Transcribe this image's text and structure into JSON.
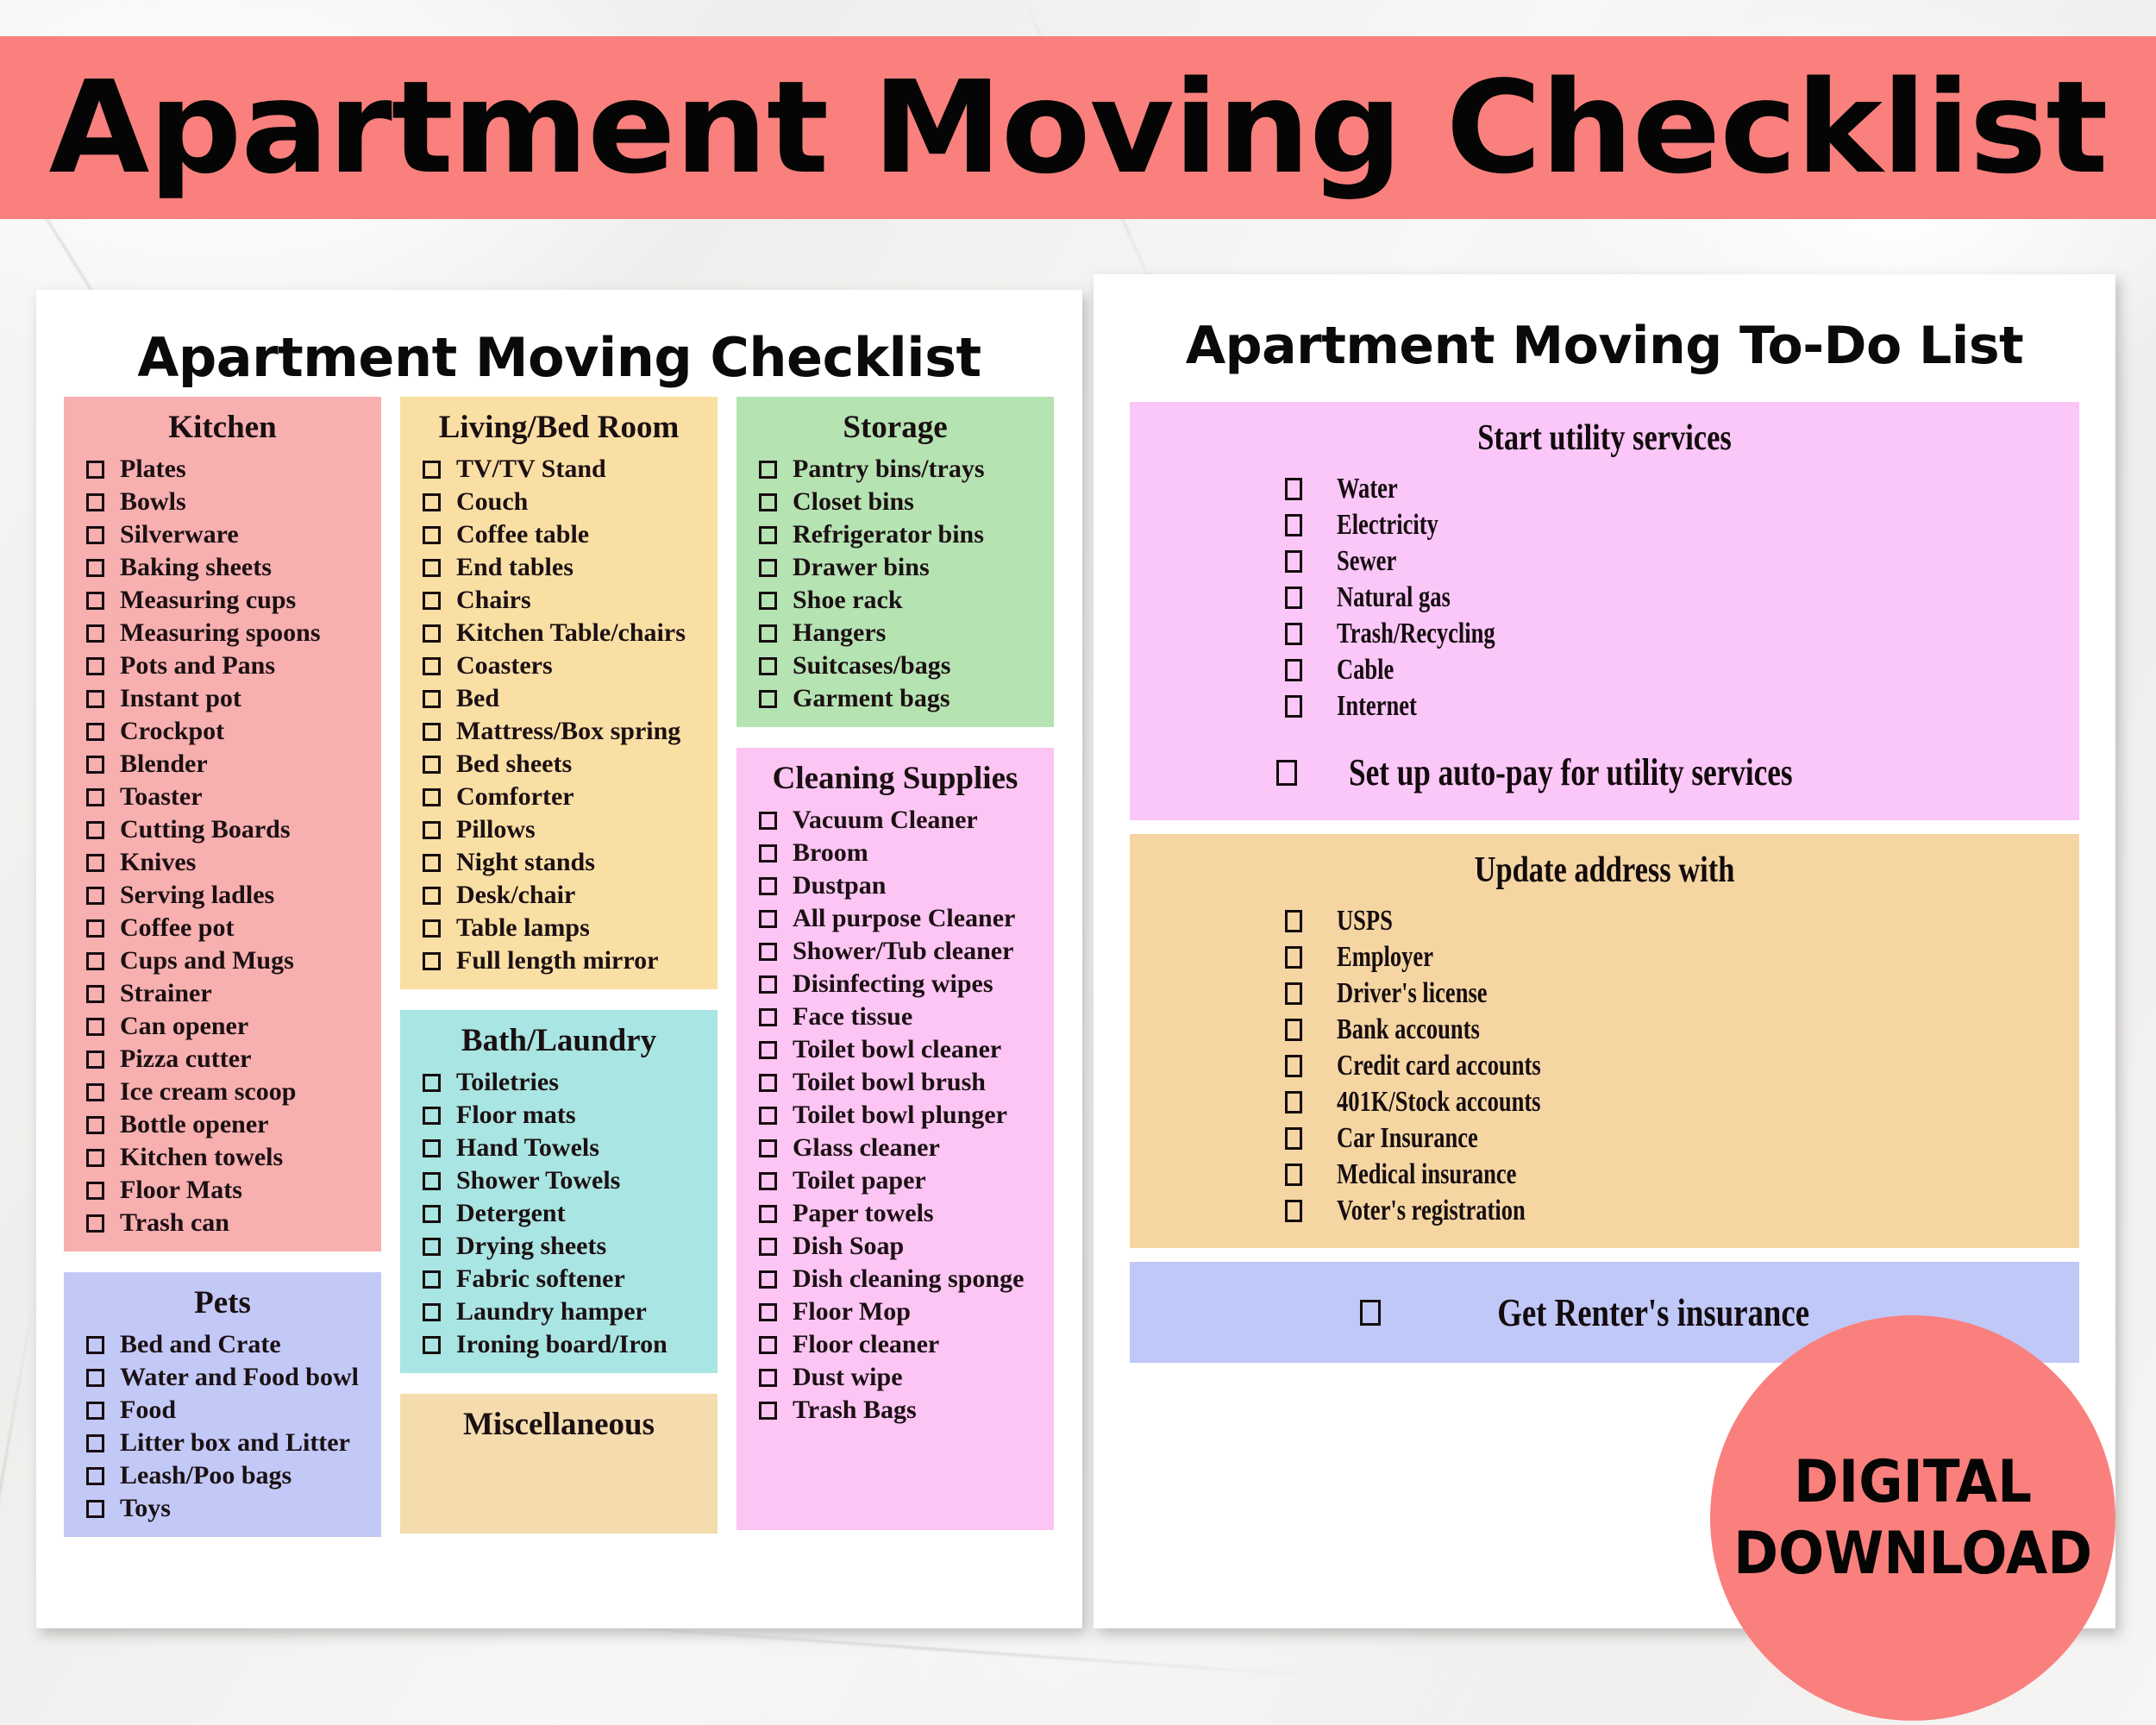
{
  "banner": {
    "title": "Apartment Moving Checklist"
  },
  "left_card": {
    "title": "Apartment Moving Checklist",
    "sections": [
      {
        "name": "Kitchen",
        "color": "#f7afaf",
        "items": [
          "Plates",
          "Bowls",
          "Silverware",
          "Baking sheets",
          "Measuring cups",
          "Measuring spoons",
          "Pots and Pans",
          "Instant pot",
          "Crockpot",
          "Blender",
          "Toaster",
          "Cutting Boards",
          "Knives",
          "Serving ladles",
          "Coffee pot",
          "Cups and Mugs",
          "Strainer",
          "Can opener",
          "Pizza cutter",
          "Ice cream scoop",
          "Bottle opener",
          "Kitchen towels",
          "Floor Mats",
          "Trash can"
        ]
      },
      {
        "name": "Pets",
        "color": "#c2c9f7",
        "items": [
          "Bed and Crate",
          "Water and Food bowl",
          "Food",
          "Litter box and Litter",
          "Leash/Poo bags",
          "Toys"
        ]
      },
      {
        "name": "Living/Bed Room",
        "color": "#fadfa4",
        "items": [
          "TV/TV Stand",
          "Couch",
          "Coffee table",
          "End tables",
          "Chairs",
          "Kitchen Table/chairs",
          "Coasters",
          "Bed",
          "Mattress/Box spring",
          "Bed sheets",
          "Comforter",
          "Pillows",
          "Night stands",
          "Desk/chair",
          "Table lamps",
          "Full length mirror"
        ]
      },
      {
        "name": "Bath/Laundry",
        "color": "#a9e5e2",
        "items": [
          "Toiletries",
          "Floor mats",
          "Hand Towels",
          "Shower Towels",
          "Detergent",
          "Drying sheets",
          "Fabric softener",
          "Laundry hamper",
          "Ironing board/Iron"
        ]
      },
      {
        "name": "Miscellaneous",
        "color": "#f5dcae",
        "items": []
      },
      {
        "name": "Storage",
        "color": "#b5e3b2",
        "items": [
          "Pantry bins/trays",
          "Closet bins",
          "Refrigerator bins",
          "Drawer bins",
          "Shoe rack",
          "Hangers",
          "Suitcases/bags",
          "Garment bags"
        ]
      },
      {
        "name": "Cleaning Supplies",
        "color": "#fcc5f3",
        "items": [
          "Vacuum Cleaner",
          "Broom",
          "Dustpan",
          "All purpose Cleaner",
          "Shower/Tub cleaner",
          "Disinfecting wipes",
          "Face tissue",
          "Toilet bowl cleaner",
          "Toilet bowl brush",
          "Toilet bowl plunger",
          "Glass cleaner",
          "Toilet paper",
          "Paper towels",
          "Dish Soap",
          "Dish cleaning sponge",
          "Floor Mop",
          "Floor cleaner",
          "Dust wipe",
          "Trash Bags"
        ]
      }
    ]
  },
  "right_card": {
    "title": "Apartment Moving To-Do List",
    "utility": {
      "title": "Start utility services",
      "color": "#fbc6f8",
      "items": [
        "Water",
        "Electricity",
        "Sewer",
        "Natural gas",
        "Trash/Recycling",
        "Cable",
        "Internet"
      ],
      "footer": "Set up auto-pay for utility services"
    },
    "address": {
      "title": "Update address with",
      "color": "#f5d5a2",
      "items": [
        "USPS",
        "Employer",
        "Driver's license",
        "Bank accounts",
        "Credit card accounts",
        "401K/Stock accounts",
        "Car Insurance",
        "Medical insurance",
        "Voter's registration"
      ]
    },
    "renter": {
      "color": "#c0c8f8",
      "label": "Get Renter's insurance"
    }
  },
  "badge": {
    "line1": "DIGITAL",
    "line2": "DOWNLOAD",
    "color": "#f9807d"
  }
}
